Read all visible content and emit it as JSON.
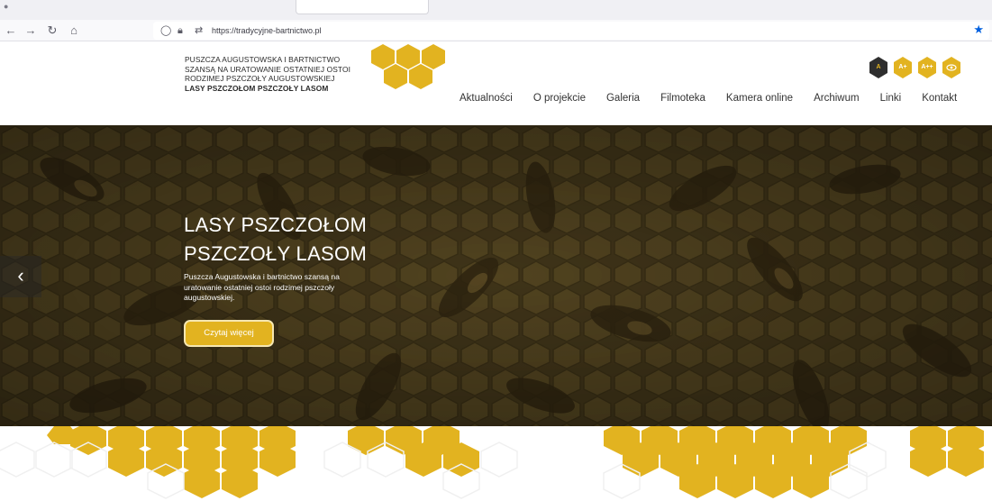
{
  "browser": {
    "url": "https://tradycyjne-bartnictwo.pl",
    "icons": [
      "back-icon",
      "forward-icon",
      "reload-icon",
      "home-icon",
      "tracking-shield-icon",
      "lock-icon",
      "permissions-icon",
      "bookmark-star-icon"
    ]
  },
  "header": {
    "logo_lines": [
      "PUSZCZA AUGUSTOWSKA I BARTNICTWO",
      "SZANSĄ NA URATOWANIE OSTATNIEJ OSTOI",
      "RODZIMEJ PSZCZOŁY AUGUSTOWSKIEJ"
    ],
    "logo_bold": "LASY PSZCZOŁOM PSZCZOŁY LASOM",
    "nav": [
      "Aktualności",
      "O projekcie",
      "Galeria",
      "Filmoteka",
      "Kamera online",
      "Archiwum",
      "Linki",
      "Kontakt"
    ],
    "accessibility": {
      "a": "A",
      "a_plus": "A+",
      "a_plus_plus": "A++",
      "contrast_icon": "eye-icon"
    }
  },
  "hero": {
    "title_line1": "LASY PSZCZOŁOM",
    "title_line2": "PSZCZOŁY LASOM",
    "subtitle": "Puszcza Augustowska i bartnictwo szansą na uratowanie ostatniej ostoi rodzimej pszczoły augustowskiej.",
    "button": "Czytaj więcej",
    "prev_arrow": "‹"
  },
  "colors": {
    "honey": "#e2b320",
    "dark_hex": "#2e2e2e",
    "hero_overlay": "#5a4a24"
  }
}
